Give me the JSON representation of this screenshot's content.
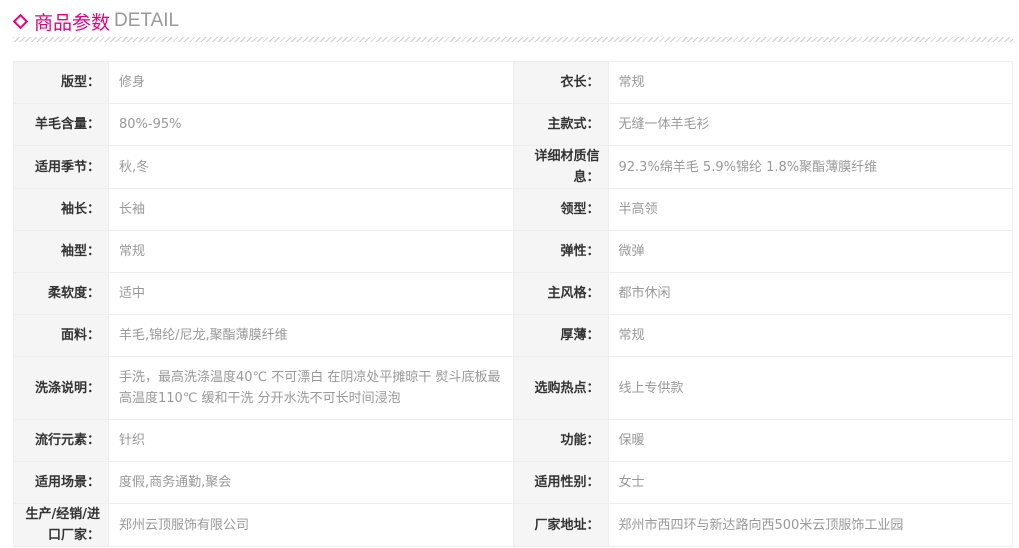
{
  "header": {
    "title_cn": "商品参数",
    "title_en": "DETAIL"
  },
  "rows": [
    [
      {
        "k": "版型：",
        "v": "修身"
      },
      {
        "k": "衣长：",
        "v": "常规"
      }
    ],
    [
      {
        "k": "羊毛含量：",
        "v": "80%-95%"
      },
      {
        "k": "主款式：",
        "v": "无缝一体羊毛衫"
      }
    ],
    [
      {
        "k": "适用季节：",
        "v": "秋,冬"
      },
      {
        "k": "详细材质信息：",
        "v": "92.3%绵羊毛 5.9%锦纶 1.8%聚酯薄膜纤维"
      }
    ],
    [
      {
        "k": "袖长：",
        "v": "长袖"
      },
      {
        "k": "领型：",
        "v": "半高领"
      }
    ],
    [
      {
        "k": "袖型：",
        "v": "常规"
      },
      {
        "k": "弹性：",
        "v": "微弹"
      }
    ],
    [
      {
        "k": "柔软度：",
        "v": "适中"
      },
      {
        "k": "主风格：",
        "v": "都市休闲"
      }
    ],
    [
      {
        "k": "面料：",
        "v": "羊毛,锦纶/尼龙,聚酯薄膜纤维"
      },
      {
        "k": "厚薄：",
        "v": "常规"
      }
    ],
    [
      {
        "k": "洗涤说明：",
        "v": "手洗，最高洗涤温度40℃ 不可漂白 在阴凉处平摊晾干 熨斗底板最高温度110℃ 缓和干洗 分开水洗不可长时间浸泡"
      },
      {
        "k": "选购热点：",
        "v": "线上专供款"
      }
    ],
    [
      {
        "k": "流行元素：",
        "v": "针织"
      },
      {
        "k": "功能：",
        "v": "保暖"
      }
    ],
    [
      {
        "k": "适用场景：",
        "v": "度假,商务通勤,聚会"
      },
      {
        "k": "适用性别：",
        "v": "女士"
      }
    ],
    [
      {
        "k": "生产/经销/进口厂家：",
        "v": "郑州云顶服饰有限公司"
      },
      {
        "k": "厂家地址：",
        "v": "郑州市西四环与新达路向西500米云顶服饰工业园"
      }
    ]
  ]
}
